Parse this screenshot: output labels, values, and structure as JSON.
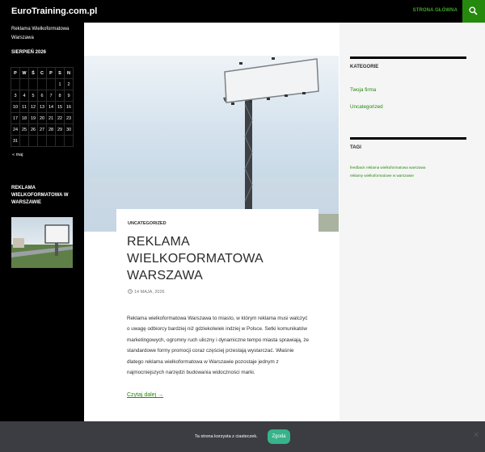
{
  "header": {
    "site_title": "EuroTraining.com.pl",
    "nav_item": "STRONA GŁÓWNA",
    "search_icon": "search-icon"
  },
  "sidebar": {
    "tagline": "Reklama Wielkoformatowa Warszawa",
    "calendar_title": "SIERPIEŃ 2026",
    "calendar_headers": [
      "P",
      "W",
      "Ś",
      "C",
      "P",
      "S",
      "N"
    ],
    "calendar_rows": [
      [
        "",
        "",
        "",
        "",
        "",
        "1",
        "2"
      ],
      [
        "3",
        "4",
        "5",
        "6",
        "7",
        "8",
        "9"
      ],
      [
        "10",
        "11",
        "12",
        "13",
        "14",
        "15",
        "16"
      ],
      [
        "17",
        "18",
        "19",
        "20",
        "21",
        "22",
        "23"
      ],
      [
        "24",
        "25",
        "26",
        "27",
        "28",
        "29",
        "30"
      ],
      [
        "31",
        "",
        "",
        "",
        "",
        "",
        ""
      ]
    ],
    "calendar_prev": "« maj",
    "widget_title": "REKLAMA WIELKOFORMATOWA W WARSZAWIE"
  },
  "post": {
    "category": "UNCATEGORIZED",
    "title": "REKLAMA WIELKOFORMATOWA WARSZAWA",
    "date": "14 MAJA, 2026",
    "excerpt": "Reklama wielkoformatowa Warszawa to miasto, w którym reklama musi walczyć o uwagę odbiorcy bardziej niż gdziekolwiek indziej w Polsce. Setki komunikatów marketingowych, ogromny ruch uliczny i dynamiczne tempo miasta sprawiają, że standardowe formy promocji coraz częściej przestają wystarczać. Właśnie dlatego reklama wielkoformatowa w Warszawie pozostaje jednym z najmocniejszych narzędzi budowania widoczności marki.",
    "read_more": "Czytaj dalej →"
  },
  "right_sidebar": {
    "categories_title": "KATEGORIE",
    "categories": [
      "Twoja firma",
      "Uncategorized"
    ],
    "tags_title": "TAGI",
    "tags": [
      "feedback reklama wielkoformatowa warszawa",
      "reklamy wielkoformatowe w warszawie"
    ]
  },
  "cookie": {
    "text": "Ta strona korzysta z ciasteczek.",
    "button": "Zgoda",
    "close_icon": "close-icon",
    "close": "✕"
  }
}
